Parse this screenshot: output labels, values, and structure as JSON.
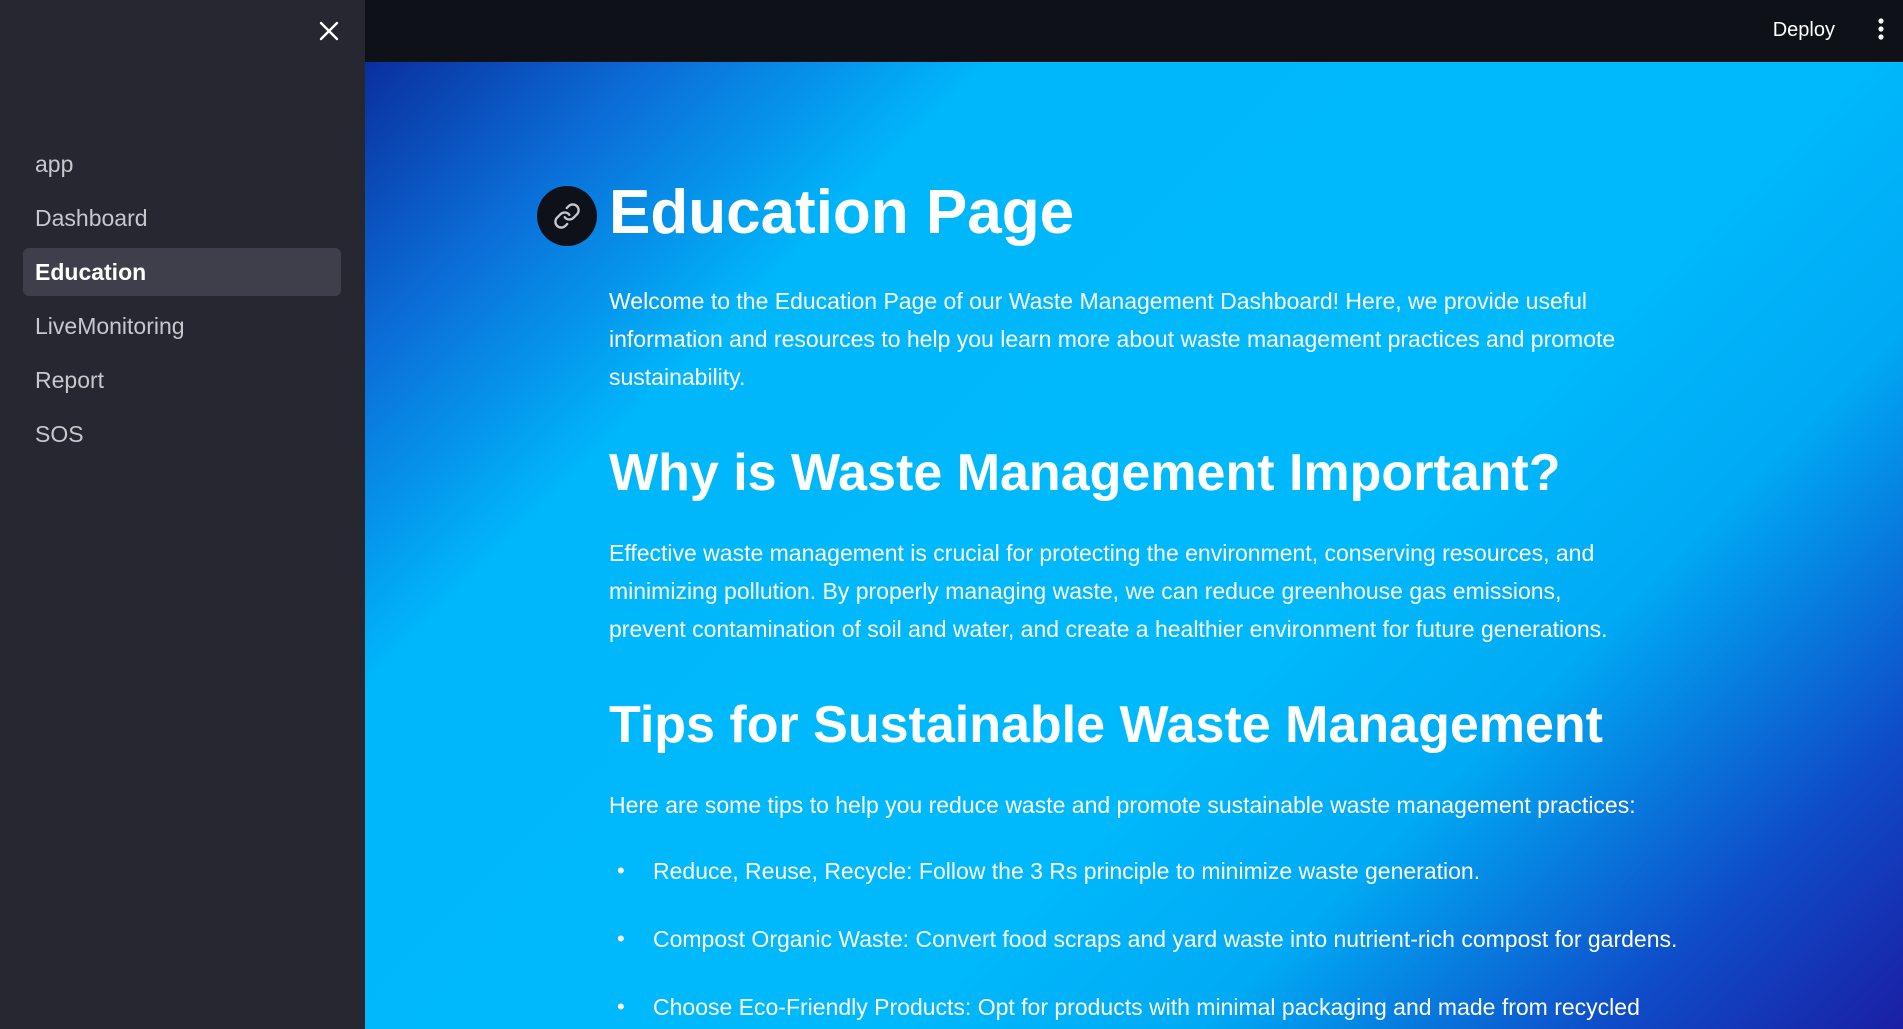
{
  "sidebar": {
    "items": [
      {
        "label": "app",
        "active": false
      },
      {
        "label": "Dashboard",
        "active": false
      },
      {
        "label": "Education",
        "active": true
      },
      {
        "label": "LiveMonitoring",
        "active": false
      },
      {
        "label": "Report",
        "active": false
      },
      {
        "label": "SOS",
        "active": false
      }
    ],
    "close_icon": "close-icon"
  },
  "header": {
    "deploy_label": "Deploy",
    "menu_icon": "kebab-menu-icon"
  },
  "main": {
    "title": "Education Page",
    "link_icon": "link-icon",
    "intro": "Welcome to the Education Page of our Waste Management Dashboard! Here, we provide useful information and resources to help you learn more about waste management practices and promote sustainability.",
    "why_heading": "Why is Waste Management Important?",
    "why_text": "Effective waste management is crucial for protecting the environment, conserving resources, and minimizing pollution. By properly managing waste, we can reduce greenhouse gas emissions, prevent contamination of soil and water, and create a healthier environment for future generations.",
    "tips_heading": "Tips for Sustainable Waste Management",
    "tips_intro": "Here are some tips to help you reduce waste and promote sustainable waste management practices:",
    "tips": [
      "Reduce, Reuse, Recycle: Follow the 3 Rs principle to minimize waste generation.",
      "Compost Organic Waste: Convert food scraps and yard waste into nutrient-rich compost for gardens.",
      "Choose Eco-Friendly Products: Opt for products with minimal packaging and made from recycled"
    ]
  },
  "colors": {
    "sidebar_bg": "#262730",
    "topbar_bg": "#0e1117",
    "active_item_bg": "#3e3f4b",
    "main_gradient_mid": "#00b8fc",
    "main_gradient_dark": "#0a2f9e"
  }
}
